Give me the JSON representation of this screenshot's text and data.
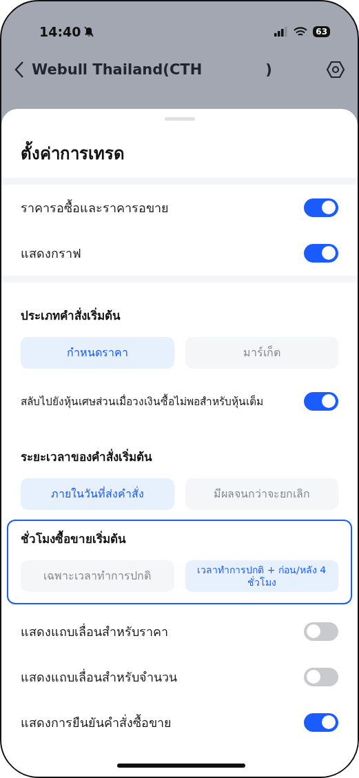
{
  "status_bar": {
    "time": "14:40",
    "battery": "63"
  },
  "nav": {
    "title": "Webull Thailand(CTH",
    "title_end": ")"
  },
  "sheet": {
    "title": "ตั้งค่าการเทรด",
    "groups": [
      {
        "banded": true,
        "items": [
          {
            "kind": "toggle",
            "label": "ราคารอซื้อและราคารอขาย",
            "on": true
          },
          {
            "kind": "toggle",
            "label": "แสดงกราฟ",
            "on": true
          }
        ]
      },
      {
        "banded": true,
        "items": [
          {
            "kind": "heading",
            "label": "ประเภทคำสั่งเริ่มต้น"
          },
          {
            "kind": "segments",
            "options": [
              {
                "label": "กำหนดราคา",
                "selected": true
              },
              {
                "label": "มาร์เก็ต",
                "selected": false
              }
            ]
          },
          {
            "kind": "toggle",
            "label": "สลับไปยังหุ้นเศษส่วนเมื่อวงเงินซื้อไม่พอสำหรับหุ้นเต็ม",
            "on": true
          },
          {
            "kind": "heading",
            "label": "ระยะเวลาของคำสั่งเริ่มต้น"
          },
          {
            "kind": "segments",
            "options": [
              {
                "label": "ภายในวันที่ส่งคำสั่ง",
                "selected": true
              },
              {
                "label": "มีผลจนกว่าจะยกเลิก",
                "selected": false
              }
            ]
          }
        ]
      },
      {
        "highlighted": true,
        "items": [
          {
            "kind": "heading",
            "label": "ชั่วโมงซื้อขายเริ่มต้น"
          },
          {
            "kind": "segments",
            "options": [
              {
                "label": "เฉพาะเวลาทำการปกติ",
                "selected": false
              },
              {
                "label": "เวลาทำการปกติ + ก่อน/หลัง 4 ชั่วโมง",
                "selected": true
              }
            ]
          }
        ]
      },
      {
        "items": [
          {
            "kind": "toggle",
            "label": "แสดงแถบเลื่อนสำหรับราคา",
            "on": false
          },
          {
            "kind": "toggle",
            "label": "แสดงแถบเลื่อนสำหรับจำนวน",
            "on": false
          },
          {
            "kind": "toggle",
            "label": "แสดงการยืนยันคำสั่งซื้อขาย",
            "on": true
          }
        ]
      }
    ]
  }
}
